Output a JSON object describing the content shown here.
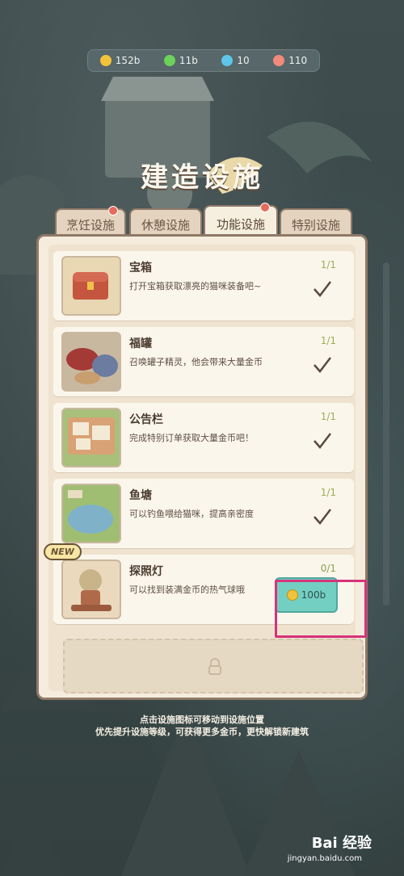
{
  "resources": [
    {
      "icon": "coin-icon",
      "value": "152b",
      "color": "#f1c33a"
    },
    {
      "icon": "lightning-icon",
      "value": "11b",
      "color": "#6bd25a"
    },
    {
      "icon": "gem-icon",
      "value": "10",
      "color": "#5ec6e8"
    },
    {
      "icon": "fish-icon",
      "value": "110",
      "color": "#f08a7a"
    }
  ],
  "title": "建造设施",
  "tabs": [
    {
      "label": "烹饪设施",
      "badge": true,
      "active": false
    },
    {
      "label": "休憩设施",
      "badge": false,
      "active": false
    },
    {
      "label": "功能设施",
      "badge": true,
      "active": true
    },
    {
      "label": "特别设施",
      "badge": false,
      "active": false
    }
  ],
  "items": [
    {
      "name": "宝箱",
      "desc": "打开宝箱获取漂亮的猫咪装备吧~",
      "count": "1/1",
      "status": "owned",
      "icon": "treasure-chest-icon"
    },
    {
      "name": "福罐",
      "desc": "召唤罐子精灵，他会带来大量金币",
      "count": "1/1",
      "status": "owned",
      "icon": "lucky-jar-icon"
    },
    {
      "name": "公告栏",
      "desc": "完成特别订单获取大量金币吧！",
      "count": "1/1",
      "status": "owned",
      "icon": "bulletin-board-icon"
    },
    {
      "name": "鱼塘",
      "desc": "可以钓鱼喂给猫咪，提高亲密度",
      "count": "1/1",
      "status": "owned",
      "icon": "fish-pond-icon"
    },
    {
      "name": "探照灯",
      "desc": "可以找到装满金币的热气球哦",
      "count": "0/1",
      "status": "buy",
      "price": "100b",
      "new_label": "NEW",
      "icon": "searchlight-icon"
    }
  ],
  "hints": {
    "line1": "点击设施图标可移动到设施位置",
    "line2": "优先提升设施等级，可获得更多金币，更快解锁新建筑"
  },
  "watermark": {
    "brand": "Bai 经验",
    "sub": "jingyan.baidu.com"
  }
}
